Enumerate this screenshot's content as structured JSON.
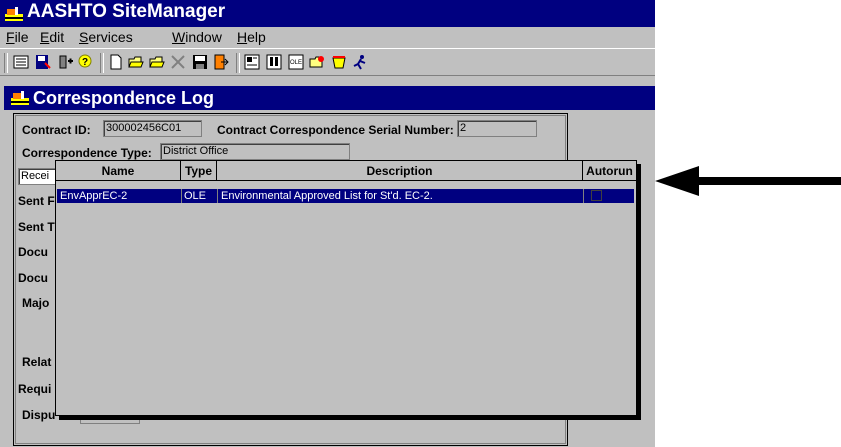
{
  "app": {
    "title": "AASHTO SiteManager",
    "menu": [
      {
        "label": "File",
        "underline": "F",
        "rest": "ile"
      },
      {
        "label": "Edit",
        "underline": "E",
        "rest": "dit"
      },
      {
        "label": "Services",
        "underline": "S",
        "rest": "ervices"
      },
      {
        "label": "Window",
        "underline": "W",
        "rest": "indow"
      },
      {
        "label": "Help",
        "underline": "H",
        "rest": "elp"
      }
    ]
  },
  "toolbar": {
    "icons": [
      "list-icon",
      "save-as-icon",
      "add-icon",
      "help-icon",
      "new-icon",
      "open-folder-icon",
      "open-folder-2-icon",
      "delete-icon",
      "save-icon",
      "exit-icon",
      "print-icon",
      "print-2-icon",
      "ole-icon",
      "attach-icon",
      "edit-icon",
      "run-icon"
    ]
  },
  "window": {
    "title": "Correspondence Log",
    "contract_id_label": "Contract ID:",
    "contract_id_value": "300002456C01",
    "serial_label": "Contract Correspondence Serial Number:",
    "serial_value": "2",
    "type_label": "Correspondence Type:",
    "type_value": "District Office",
    "received_value": "Recei",
    "left_labels": [
      "Sent F",
      "Sent T",
      "Docu",
      "Docu",
      "Majo",
      "Relat",
      "Requi",
      "Dispu"
    ]
  },
  "popup": {
    "columns": [
      "Name",
      "Type",
      "Description",
      "Autorun"
    ],
    "rows": [
      {
        "name": "EnvApprEC-2",
        "type": "OLE",
        "description": "Environmental Approved List for St'd. EC-2.",
        "autorun": false
      }
    ]
  },
  "colors": {
    "titlebar": "#000080",
    "selection": "#000080",
    "face": "#c0c0c0"
  }
}
